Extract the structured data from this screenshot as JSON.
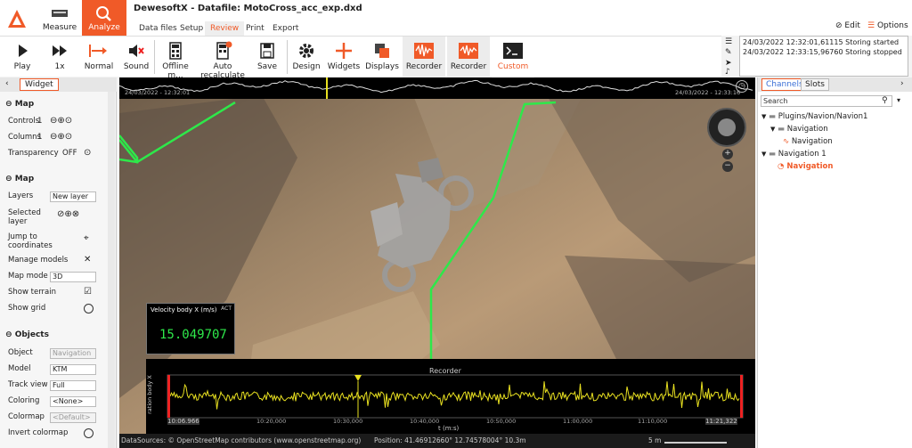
{
  "app": {
    "title": "DewesoftX - Datafile: MotoCross_acc_exp.dxd",
    "modes": [
      "Measure",
      "Analyze"
    ],
    "tabs": [
      "Data files",
      "Setup",
      "Review",
      "Print",
      "Export"
    ],
    "edit_label": "Edit",
    "options_label": "Options"
  },
  "toolbar": {
    "play": "Play",
    "speed": "1x",
    "normal": "Normal",
    "sound": "Sound",
    "offline": "Offline m...",
    "autorecalc": "Auto recalculate",
    "save": "Save",
    "design": "Design",
    "widgets": "Widgets",
    "displays": "Displays",
    "recorder1": "Recorder",
    "recorder2": "Recorder",
    "custom": "Custom"
  },
  "log": [
    "24/03/2022 12:32:01,61115 Storing started",
    "24/03/2022 12:33:15,96760 Storing stopped"
  ],
  "left": {
    "tab": "Widget",
    "sec_map1": "Map",
    "controls": {
      "label": "Controls",
      "value": "1"
    },
    "columns": {
      "label": "Columns",
      "value": "1"
    },
    "transparency": {
      "label": "Transparency",
      "value": "OFF"
    },
    "sec_map2": "Map",
    "layers": {
      "label": "Layers",
      "value": "New layer"
    },
    "selected_layer": "Selected layer",
    "jump": "Jump to coordinates",
    "manage": "Manage models",
    "map_mode": {
      "label": "Map mode",
      "value": "3D"
    },
    "show_terrain": "Show terrain",
    "show_grid": "Show grid",
    "sec_objects": "Objects",
    "object": {
      "label": "Object",
      "value": "Navigation"
    },
    "model": {
      "label": "Model",
      "value": "KTM"
    },
    "track_view": {
      "label": "Track view",
      "value": "Full"
    },
    "coloring": {
      "label": "Coloring",
      "value": "<None>"
    },
    "colormap": {
      "label": "Colormap",
      "value": "<Default>"
    },
    "invert": "Invert colormap"
  },
  "view": {
    "overview_start": "24/03/2022 - 12:32:01",
    "overview_end": "24/03/2022 - 12:33:16",
    "velocity_title": "Velocity body X (m/s)",
    "velocity_tag": "ACT",
    "velocity_value": "15.049707",
    "recorder_title": "Recorder",
    "recorder_ylabel": "ration body X",
    "recorder_xlabel": "t (m:s)",
    "recorder_ticks": [
      "10:06.966",
      "10:20,000",
      "10:30,000",
      "10:40,000",
      "10:50,000",
      "11:00,000",
      "11:10,000",
      "11:21,322"
    ]
  },
  "status": {
    "datasources": "DataSources: © OpenStreetMap contributors (www.openstreetmap.org)",
    "position": "Position: 41.46912660° 12.74578004° 10.3m",
    "scale": "5 m"
  },
  "right": {
    "tab_channels": "Channels",
    "tab_slots": "Slots",
    "search": "Search",
    "tree": [
      "Plugins/Navion/Navion1",
      "Navigation",
      "Navigation",
      "Navigation 1",
      "Navigation"
    ]
  },
  "colors": {
    "accent": "#f05a28",
    "track": "#2ee84a",
    "signal": "#e8e020"
  }
}
